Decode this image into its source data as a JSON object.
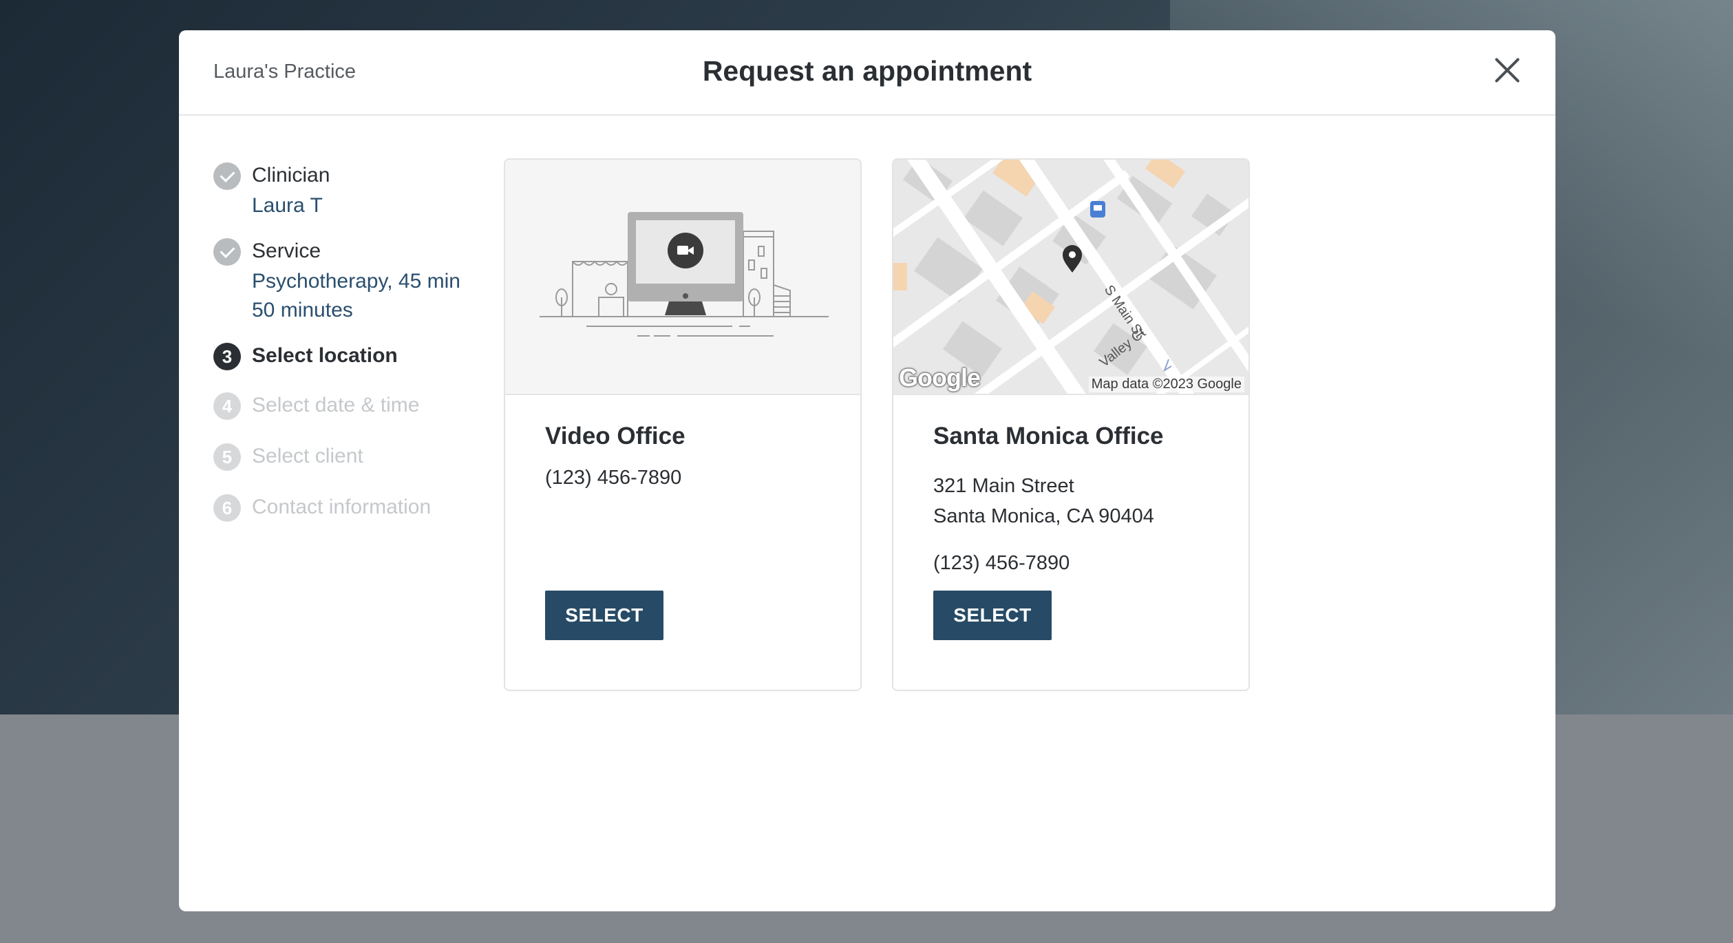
{
  "header": {
    "practice_name": "Laura's Practice",
    "title": "Request an appointment",
    "close_icon": "close-icon"
  },
  "steps": [
    {
      "number": "1",
      "label": "Clinician",
      "value": "Laura T",
      "state": "done"
    },
    {
      "number": "2",
      "label": "Service",
      "value": "Psychotherapy, 45 min",
      "value2": "50 minutes",
      "state": "done"
    },
    {
      "number": "3",
      "label": "Select location",
      "state": "active"
    },
    {
      "number": "4",
      "label": "Select date & time",
      "state": "todo"
    },
    {
      "number": "5",
      "label": "Select client",
      "state": "todo"
    },
    {
      "number": "6",
      "label": "Contact information",
      "state": "todo"
    }
  ],
  "locations": [
    {
      "name": "Video Office",
      "phone": "(123) 456-7890",
      "select_label": "SELECT",
      "image_icon": "video-office-illustration"
    },
    {
      "name": "Santa Monica Office",
      "address_line1": "321 Main Street",
      "address_line2": "Santa Monica, CA 90404",
      "phone": "(123) 456-7890",
      "select_label": "SELECT",
      "map": {
        "logo": "Google",
        "credit": "Map data ©2023 Google",
        "street_1": "S Main St",
        "street_2": "Valley Ct"
      }
    }
  ],
  "colors": {
    "accent": "#274b66",
    "link": "#2a4e6e",
    "text": "#2b2f33",
    "muted": "#c5c8cb"
  }
}
